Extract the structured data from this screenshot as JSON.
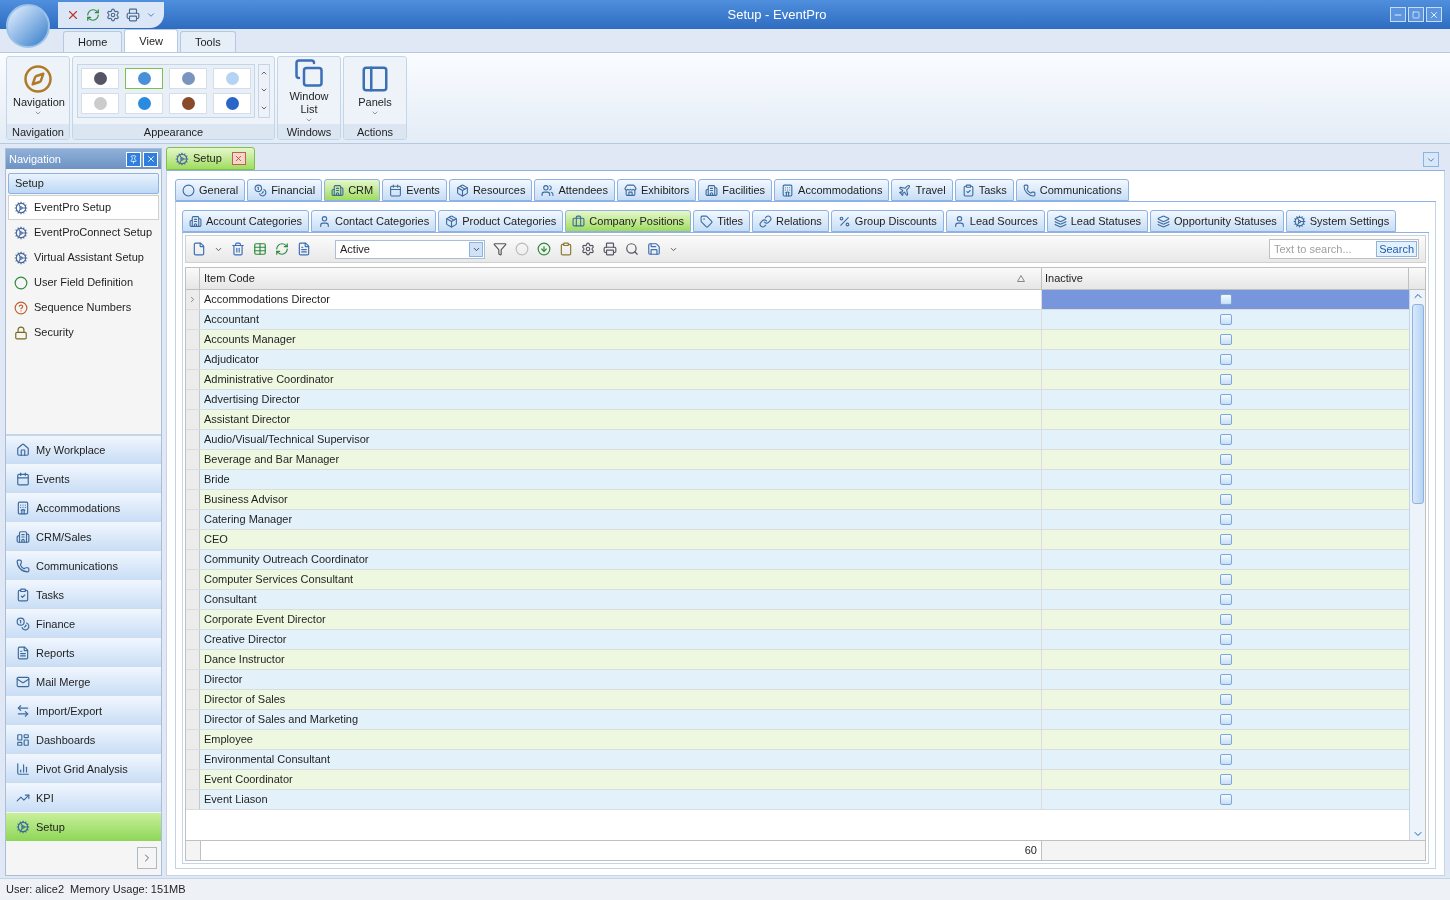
{
  "window": {
    "title": "Setup - EventPro"
  },
  "ribbon_tabs": [
    {
      "label": "Home",
      "selected": false
    },
    {
      "label": "View",
      "selected": true
    },
    {
      "label": "Tools",
      "selected": false
    }
  ],
  "ribbon_groups": [
    {
      "kind": "large",
      "caption": "Navigation",
      "button": "Navigation"
    },
    {
      "kind": "swatches",
      "caption": "Appearance",
      "swatches": [
        {
          "selected": false
        },
        {
          "selected": true
        },
        {
          "selected": false
        },
        {
          "selected": false
        },
        {
          "selected": false
        },
        {
          "selected": false
        },
        {
          "selected": false
        },
        {
          "selected": false
        }
      ]
    },
    {
      "kind": "large",
      "caption": "Windows",
      "button": "Window List"
    },
    {
      "kind": "large",
      "caption": "Actions",
      "button": "Panels"
    }
  ],
  "navigation": {
    "title": "Navigation",
    "group": "Setup",
    "items": [
      {
        "label": "EventPro Setup",
        "selected": true
      },
      {
        "label": "EventProConnect Setup",
        "selected": false
      },
      {
        "label": "Virtual Assistant Setup",
        "selected": false
      },
      {
        "label": "User Field Definition",
        "selected": false
      },
      {
        "label": "Sequence Numbers",
        "selected": false
      },
      {
        "label": "Security",
        "selected": false
      }
    ],
    "modules": [
      {
        "label": "My Workplace",
        "selected": false
      },
      {
        "label": "Events",
        "selected": false
      },
      {
        "label": "Accommodations",
        "selected": false
      },
      {
        "label": "CRM/Sales",
        "selected": false
      },
      {
        "label": "Communications",
        "selected": false
      },
      {
        "label": "Tasks",
        "selected": false
      },
      {
        "label": "Finance",
        "selected": false
      },
      {
        "label": "Reports",
        "selected": false
      },
      {
        "label": "Mail Merge",
        "selected": false
      },
      {
        "label": "Import/Export",
        "selected": false
      },
      {
        "label": "Dashboards",
        "selected": false
      },
      {
        "label": "Pivot Grid Analysis",
        "selected": false
      },
      {
        "label": "KPI",
        "selected": false
      },
      {
        "label": "Setup",
        "selected": true
      }
    ]
  },
  "document_tab": {
    "label": "Setup"
  },
  "module_tabs": [
    {
      "label": "General",
      "selected": false
    },
    {
      "label": "Financial",
      "selected": false
    },
    {
      "label": "CRM",
      "selected": true
    },
    {
      "label": "Events",
      "selected": false
    },
    {
      "label": "Resources",
      "selected": false
    },
    {
      "label": "Attendees",
      "selected": false
    },
    {
      "label": "Exhibitors",
      "selected": false
    },
    {
      "label": "Facilities",
      "selected": false
    },
    {
      "label": "Accommodations",
      "selected": false
    },
    {
      "label": "Travel",
      "selected": false
    },
    {
      "label": "Tasks",
      "selected": false
    },
    {
      "label": "Communications",
      "selected": false
    }
  ],
  "sub_tabs": [
    {
      "label": "Account Categories",
      "selected": false
    },
    {
      "label": "Contact Categories",
      "selected": false
    },
    {
      "label": "Product Categories",
      "selected": false
    },
    {
      "label": "Company Positions",
      "selected": true
    },
    {
      "label": "Titles",
      "selected": false
    },
    {
      "label": "Relations",
      "selected": false
    },
    {
      "label": "Group Discounts",
      "selected": false
    },
    {
      "label": "Lead Sources",
      "selected": false
    },
    {
      "label": "Lead Statuses",
      "selected": false
    },
    {
      "label": "Opportunity Statuses",
      "selected": false
    },
    {
      "label": "System Settings",
      "selected": false
    }
  ],
  "toolbar": {
    "filter": "Active",
    "search": {
      "placeholder": "Text to search...",
      "button": "Search"
    }
  },
  "table": {
    "columns": [
      "Item Code",
      "Inactive"
    ],
    "rows": [
      {
        "item_code": "Accommodations Director",
        "inactive": false,
        "selected": true
      },
      {
        "item_code": "Accountant",
        "inactive": false,
        "selected": false
      },
      {
        "item_code": "Accounts Manager",
        "inactive": false,
        "selected": false
      },
      {
        "item_code": "Adjudicator",
        "inactive": false,
        "selected": false
      },
      {
        "item_code": "Administrative Coordinator",
        "inactive": false,
        "selected": false
      },
      {
        "item_code": "Advertising Director",
        "inactive": false,
        "selected": false
      },
      {
        "item_code": "Assistant Director",
        "inactive": false,
        "selected": false
      },
      {
        "item_code": "Audio/Visual/Technical Supervisor",
        "inactive": false,
        "selected": false
      },
      {
        "item_code": "Beverage and Bar Manager",
        "inactive": false,
        "selected": false
      },
      {
        "item_code": "Bride",
        "inactive": false,
        "selected": false
      },
      {
        "item_code": "Business Advisor",
        "inactive": false,
        "selected": false
      },
      {
        "item_code": "Catering Manager",
        "inactive": false,
        "selected": false
      },
      {
        "item_code": "CEO",
        "inactive": false,
        "selected": false
      },
      {
        "item_code": "Community Outreach Coordinator",
        "inactive": false,
        "selected": false
      },
      {
        "item_code": "Computer Services Consultant",
        "inactive": false,
        "selected": false
      },
      {
        "item_code": "Consultant",
        "inactive": false,
        "selected": false
      },
      {
        "item_code": "Corporate Event Director",
        "inactive": false,
        "selected": false
      },
      {
        "item_code": "Creative Director",
        "inactive": false,
        "selected": false
      },
      {
        "item_code": "Dance Instructor",
        "inactive": false,
        "selected": false
      },
      {
        "item_code": "Director",
        "inactive": false,
        "selected": false
      },
      {
        "item_code": "Director of Sales",
        "inactive": false,
        "selected": false
      },
      {
        "item_code": "Director of Sales and Marketing",
        "inactive": false,
        "selected": false
      },
      {
        "item_code": "Employee",
        "inactive": false,
        "selected": false
      },
      {
        "item_code": "Environmental Consultant",
        "inactive": false,
        "selected": false
      },
      {
        "item_code": "Event Coordinator",
        "inactive": false,
        "selected": false
      },
      {
        "item_code": "Event Liason",
        "inactive": false,
        "selected": false
      }
    ],
    "footer": {
      "count": "60"
    }
  },
  "status_bar": {
    "user": "User: alice2",
    "memory": "Memory Usage: 151MB"
  }
}
